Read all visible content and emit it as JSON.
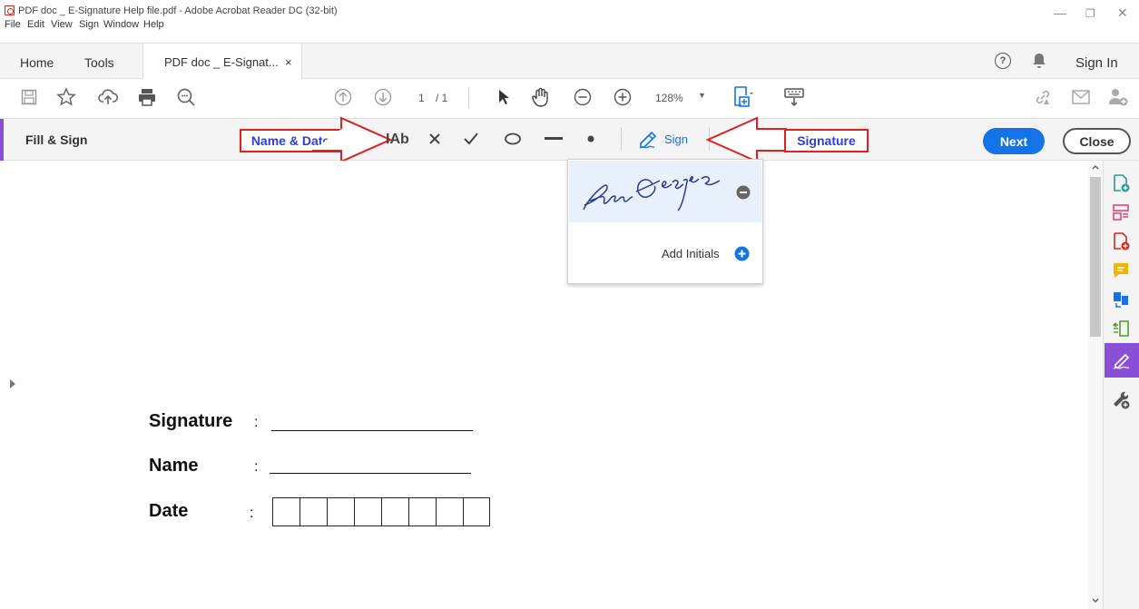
{
  "window": {
    "title": "PDF doc _ E-Signature Help file.pdf - Adobe Acrobat Reader DC (32-bit)",
    "controls": {
      "minimize": "—",
      "restore": "❐",
      "close": "✕"
    }
  },
  "menu": [
    "File",
    "Edit",
    "View",
    "Sign",
    "Window",
    "Help"
  ],
  "tabs": {
    "home": "Home",
    "tools": "Tools",
    "document": "PDF doc _ E-Signat...",
    "close_glyph": "×",
    "sign_in": "Sign In"
  },
  "toolbar": {
    "page_current": "1",
    "page_total": "/ 1",
    "zoom": "128%"
  },
  "fill_sign": {
    "title": "Fill & Sign",
    "text_tool": "IAb",
    "sign_label": "Sign",
    "next": "Next",
    "close": "Close"
  },
  "annotations": {
    "name_date": "Name & Date",
    "signature": "Signature",
    "color": "#e02020"
  },
  "signature_panel": {
    "signature_text": "Sam George",
    "add_initials": "Add Initials"
  },
  "document_form": {
    "signature_label": "Signature",
    "name_label": "Name",
    "date_label": "Date",
    "colon": ":",
    "date_boxes": 8
  },
  "colors": {
    "accent_purple": "#8a4fd8",
    "primary_blue": "#1473e6",
    "annotation_text": "#2c3fd6"
  }
}
